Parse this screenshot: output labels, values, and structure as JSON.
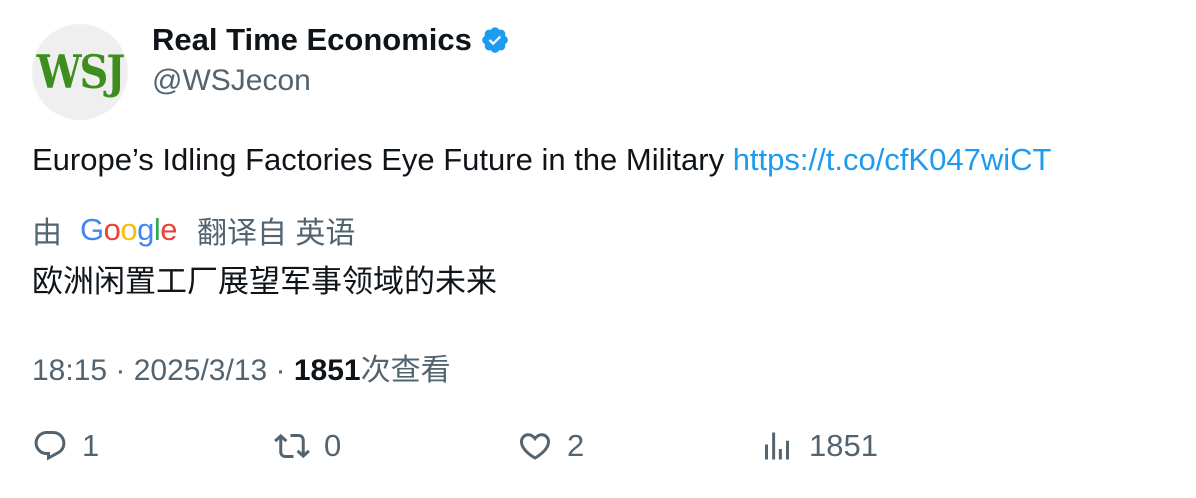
{
  "author": {
    "avatar_text": "WSJ",
    "display_name": "Real Time Economics",
    "handle": "@WSJecon",
    "verified_icon": "verified-badge-icon"
  },
  "tweet": {
    "text": "Europe’s Idling Factories Eye Future in the Military ",
    "link": "https://t.co/cfK047wiCT"
  },
  "translation": {
    "prefix": "由",
    "provider": "Google",
    "suffix": "翻译自 英语",
    "text": "欧洲闲置工厂展望军事领域的未来"
  },
  "meta": {
    "time": "18:15 · 2025/3/13 · ",
    "views_count": "1851",
    "views_label": "次查看"
  },
  "actions": {
    "reply_count": "1",
    "retweet_count": "0",
    "like_count": "2",
    "views_count": "1851"
  },
  "colors": {
    "link": "#1d9bf0",
    "secondary_text": "#536471",
    "verified": "#1d9bf0",
    "wsj_logo": "#3e8e1f"
  }
}
